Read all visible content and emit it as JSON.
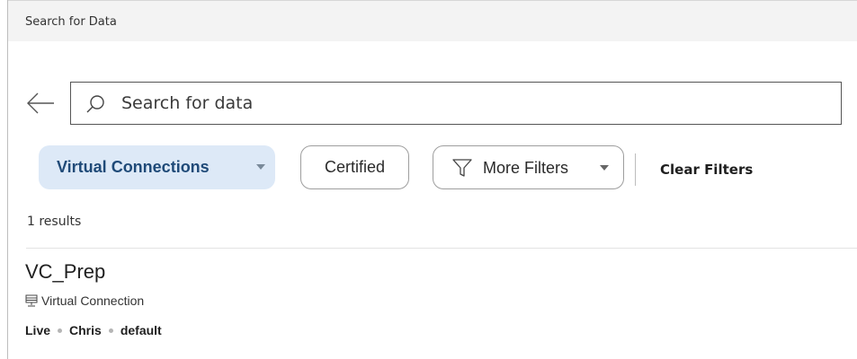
{
  "window": {
    "title": "Search for Data"
  },
  "search": {
    "placeholder": "Search for data",
    "value": ""
  },
  "filters": {
    "virtual_connections_label": "Virtual Connections",
    "certified_label": "Certified",
    "more_filters_label": "More Filters",
    "clear_filters_label": "Clear Filters"
  },
  "results": {
    "count_text": "1 results",
    "items": [
      {
        "title": "VC_Prep",
        "type": "Virtual Connection",
        "mode": "Live",
        "owner": "Chris",
        "project": "default"
      }
    ]
  },
  "colors": {
    "chip_active_bg": "#dde9f7",
    "chip_active_text": "#1f4a78",
    "title_bar_bg": "#f3f3f3"
  },
  "icons": [
    "back-arrow-icon",
    "search-icon",
    "caret-down-icon",
    "filter-icon",
    "virtual-connection-icon"
  ]
}
